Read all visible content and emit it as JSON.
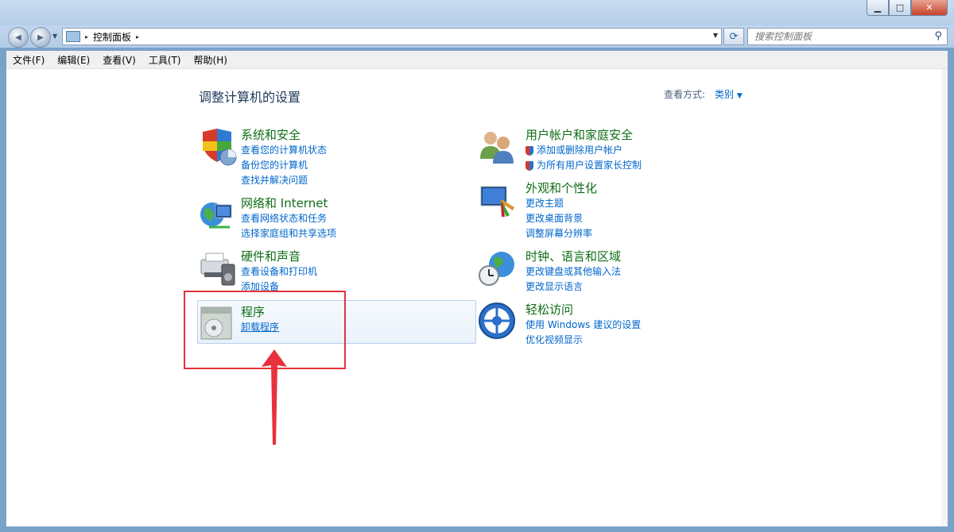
{
  "window": {
    "min_glyph": "▁",
    "max_glyph": "□",
    "close_glyph": "✕"
  },
  "nav": {
    "back_glyph": "◀",
    "forward_glyph": "▶"
  },
  "address": {
    "path": "控制面板",
    "separator": "▸"
  },
  "search": {
    "placeholder": "搜索控制面板"
  },
  "menu": [
    "文件(F)",
    "编辑(E)",
    "查看(V)",
    "工具(T)",
    "帮助(H)"
  ],
  "main": {
    "heading": "调整计算机的设置",
    "view_by_label": "查看方式:",
    "view_by_value": "类别"
  },
  "categories": {
    "system": {
      "title": "系统和安全",
      "links": [
        "查看您的计算机状态",
        "备份您的计算机",
        "查找并解决问题"
      ]
    },
    "network": {
      "title": "网络和 Internet",
      "links": [
        "查看网络状态和任务",
        "选择家庭组和共享选项"
      ]
    },
    "hardware": {
      "title": "硬件和声音",
      "links": [
        "查看设备和打印机",
        "添加设备"
      ]
    },
    "programs": {
      "title": "程序",
      "links": [
        "卸载程序"
      ]
    },
    "users": {
      "title": "用户帐户和家庭安全",
      "links": [
        "添加或删除用户帐户",
        "为所有用户设置家长控制"
      ]
    },
    "appearance": {
      "title": "外观和个性化",
      "links": [
        "更改主题",
        "更改桌面背景",
        "调整屏幕分辨率"
      ]
    },
    "clock": {
      "title": "时钟、语言和区域",
      "links": [
        "更改键盘或其他输入法",
        "更改显示语言"
      ]
    },
    "ease": {
      "title": "轻松访问",
      "links": [
        "使用 Windows 建议的设置",
        "优化视频显示"
      ]
    }
  },
  "annotation": {
    "color": "#e8313c"
  }
}
